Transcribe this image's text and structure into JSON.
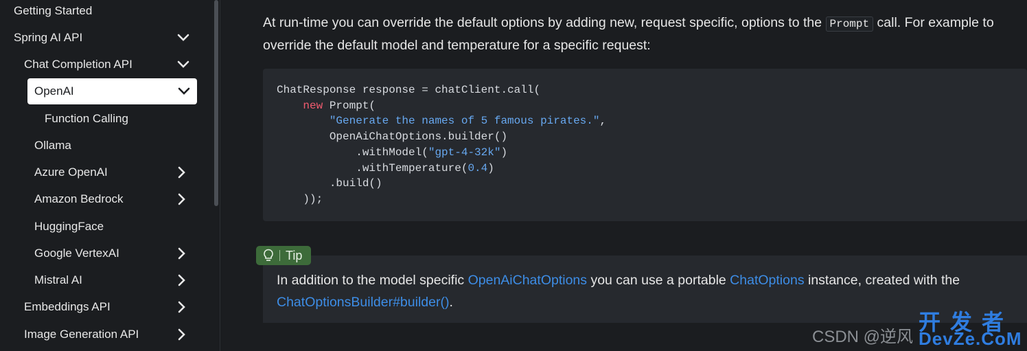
{
  "sidebar": {
    "items": [
      {
        "label": "Getting Started"
      },
      {
        "label": "Spring AI API"
      },
      {
        "label": "Chat Completion API"
      },
      {
        "label": "OpenAI"
      },
      {
        "label": "Function Calling"
      },
      {
        "label": "Ollama"
      },
      {
        "label": "Azure OpenAI"
      },
      {
        "label": "Amazon Bedrock"
      },
      {
        "label": "HuggingFace"
      },
      {
        "label": "Google VertexAI"
      },
      {
        "label": "Mistral AI"
      },
      {
        "label": "Embeddings API"
      },
      {
        "label": "Image Generation API"
      }
    ]
  },
  "content": {
    "intro_part1": "At run-time you can override the default options by adding new, request specific, options to the ",
    "intro_code": "Prompt",
    "intro_part2": " call. For example to override the default model and temperature for a specific request:",
    "code": {
      "l1": "ChatResponse response = chatClient.call(",
      "l2_kw": "new",
      "l2_rest": " Prompt(",
      "l3_str": "\"Generate the names of 5 famous pirates.\"",
      "l3_rest": ",",
      "l4": "OpenAiChatOptions.builder()",
      "l5_pre": ".withModel(",
      "l5_str": "\"gpt-4-32k\"",
      "l5_post": ")",
      "l6_pre": ".withTemperature(",
      "l6_num": "0.4",
      "l6_post": ")",
      "l7": ".build()",
      "l8": "));"
    },
    "tip": {
      "label": "Tip",
      "text1": "In addition to the model specific ",
      "link1": "OpenAiChatOptions",
      "text2": " you can use a portable ",
      "link2": "ChatOptions",
      "text3": " instance, created with the ",
      "link3": "ChatOptionsBuilder#builder()",
      "text4": "."
    }
  },
  "watermark": {
    "text": "CSDN @逆风",
    "brand_top": "开发者",
    "brand_bottom": "DevZe.CoM"
  }
}
